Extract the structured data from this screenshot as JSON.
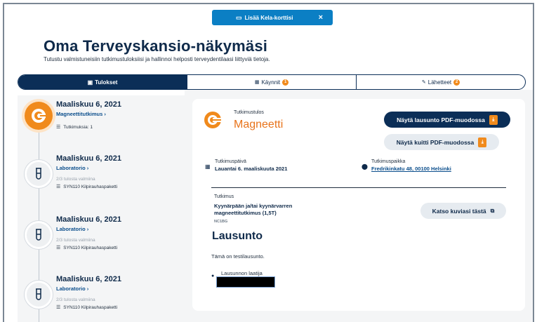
{
  "banner": {
    "label": "Lisää Kela-korttisi",
    "close": "×"
  },
  "page": {
    "title": "Oma Terveyskansio-näkymäsi",
    "subtitle": "Tutustu valmistuneisiin tutkimustuloksiisi ja hallinnoi helposti terveydentilaasi liittyviä tietoja."
  },
  "tabs": [
    {
      "label": "Tulokset",
      "badge": ""
    },
    {
      "label": "Käynnit",
      "badge": "1"
    },
    {
      "label": "Lähetteet",
      "badge": "2"
    }
  ],
  "timeline": [
    {
      "date": "Maaliskuu 6, 2021",
      "type": "Magneettitutkimus ›",
      "meta": "",
      "line": "Tutkimuksia: 1",
      "icon": "magnet-icon"
    },
    {
      "date": "Maaliskuu 6, 2021",
      "type": "Laboratorio ›",
      "meta": "2/3 tulosta valmiina",
      "line": "SYN110 Kilpirauhaspaketti",
      "icon": "test-tube-icon"
    },
    {
      "date": "Maaliskuu 6, 2021",
      "type": "Laboratorio ›",
      "meta": "2/3 tulosta valmiina",
      "line": "SYN110 Kilpirauhaspaketti",
      "icon": "test-tube-icon"
    },
    {
      "date": "Maaliskuu 6, 2021",
      "type": "Laboratorio ›",
      "meta": "2/3 tulosta valmiina",
      "line": "SYN110 Kilpirauhaspaketti",
      "icon": "test-tube-icon"
    }
  ],
  "detail": {
    "result_label": "Tutkimustulos",
    "result_name": "Magneetti",
    "pdf_statement_button": "Näytä lausunto PDF-muodossa",
    "pdf_receipt_button": "Näytä kuitti PDF-muodossa",
    "date_label": "Tutkimuspäivä",
    "date_value": "Lauantai 6. maaliskuuta 2021",
    "place_label": "Tutkimuspaikka",
    "place_value": "Fredrikinkatu 48, 00100 Helsinki",
    "study_label": "Tutkimus",
    "study_name": "Kyynärpään ja/tai kyynärvarren magneettitutkimus (1,5T)",
    "study_code": "NC1BG",
    "view_images_button": "Katso kuviasi tästä",
    "statement_title": "Lausunto",
    "statement_text": "Tämä on testilausunto.",
    "author_label": "Lausunnon laatija"
  },
  "colors": {
    "navy": "#0b2e57",
    "orange": "#f08a1c",
    "banner_blue": "#0b7fc4"
  }
}
